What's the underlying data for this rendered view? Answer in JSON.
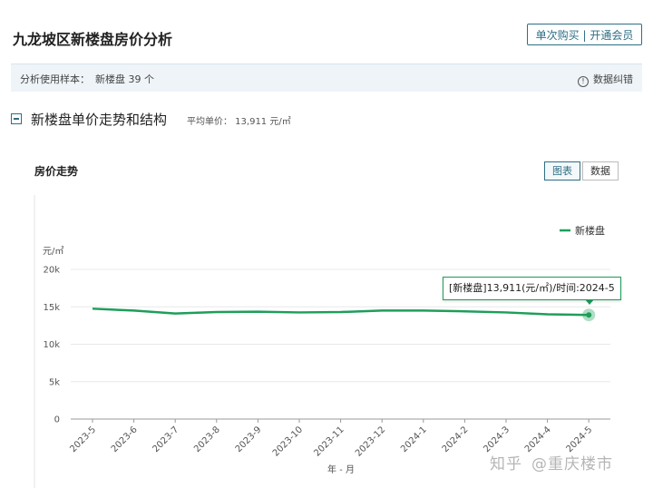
{
  "header": {
    "title": "九龙坡区新楼盘房价分析",
    "buy_button": "单次购买 | 开通会员"
  },
  "sample_bar": {
    "label": "分析使用样本：",
    "value": "新楼盘 39 个",
    "info_icon": "info-icon",
    "correction_label": "数据纠错"
  },
  "section": {
    "collapse_icon": "minus-square-icon",
    "title": "新楼盘单价走势和结构",
    "avg_price": "平均单价： 13,911 元/㎡"
  },
  "chart_panel": {
    "title": "房价走势",
    "tabs": [
      {
        "label": "图表",
        "active": true
      },
      {
        "label": "数据",
        "active": false
      }
    ]
  },
  "tooltip": {
    "text": "[新楼盘]13,911(元/㎡)/时间:2024-5"
  },
  "watermark": {
    "left": "知乎",
    "right": "@重庆楼市"
  },
  "chart_data": {
    "type": "line",
    "xlabel": "年 - 月",
    "ylabel": "元/㎡",
    "ylim": [
      0,
      20000
    ],
    "y_ticks": [
      {
        "value": 0,
        "label": "0"
      },
      {
        "value": 5000,
        "label": "5k"
      },
      {
        "value": 10000,
        "label": "10k"
      },
      {
        "value": 15000,
        "label": "15k"
      },
      {
        "value": 20000,
        "label": "20k"
      }
    ],
    "categories": [
      "2023-5",
      "2023-6",
      "2023-7",
      "2023-8",
      "2023-9",
      "2023-10",
      "2023-11",
      "2023-12",
      "2024-1",
      "2024-2",
      "2024-3",
      "2024-4",
      "2024-5"
    ],
    "series": [
      {
        "name": "新楼盘",
        "color": "#1e9e5a",
        "values": [
          14750,
          14500,
          14100,
          14300,
          14350,
          14250,
          14300,
          14500,
          14500,
          14400,
          14250,
          14000,
          13911
        ]
      }
    ],
    "grid": true,
    "legend": "top-right",
    "highlight_index": 12
  }
}
